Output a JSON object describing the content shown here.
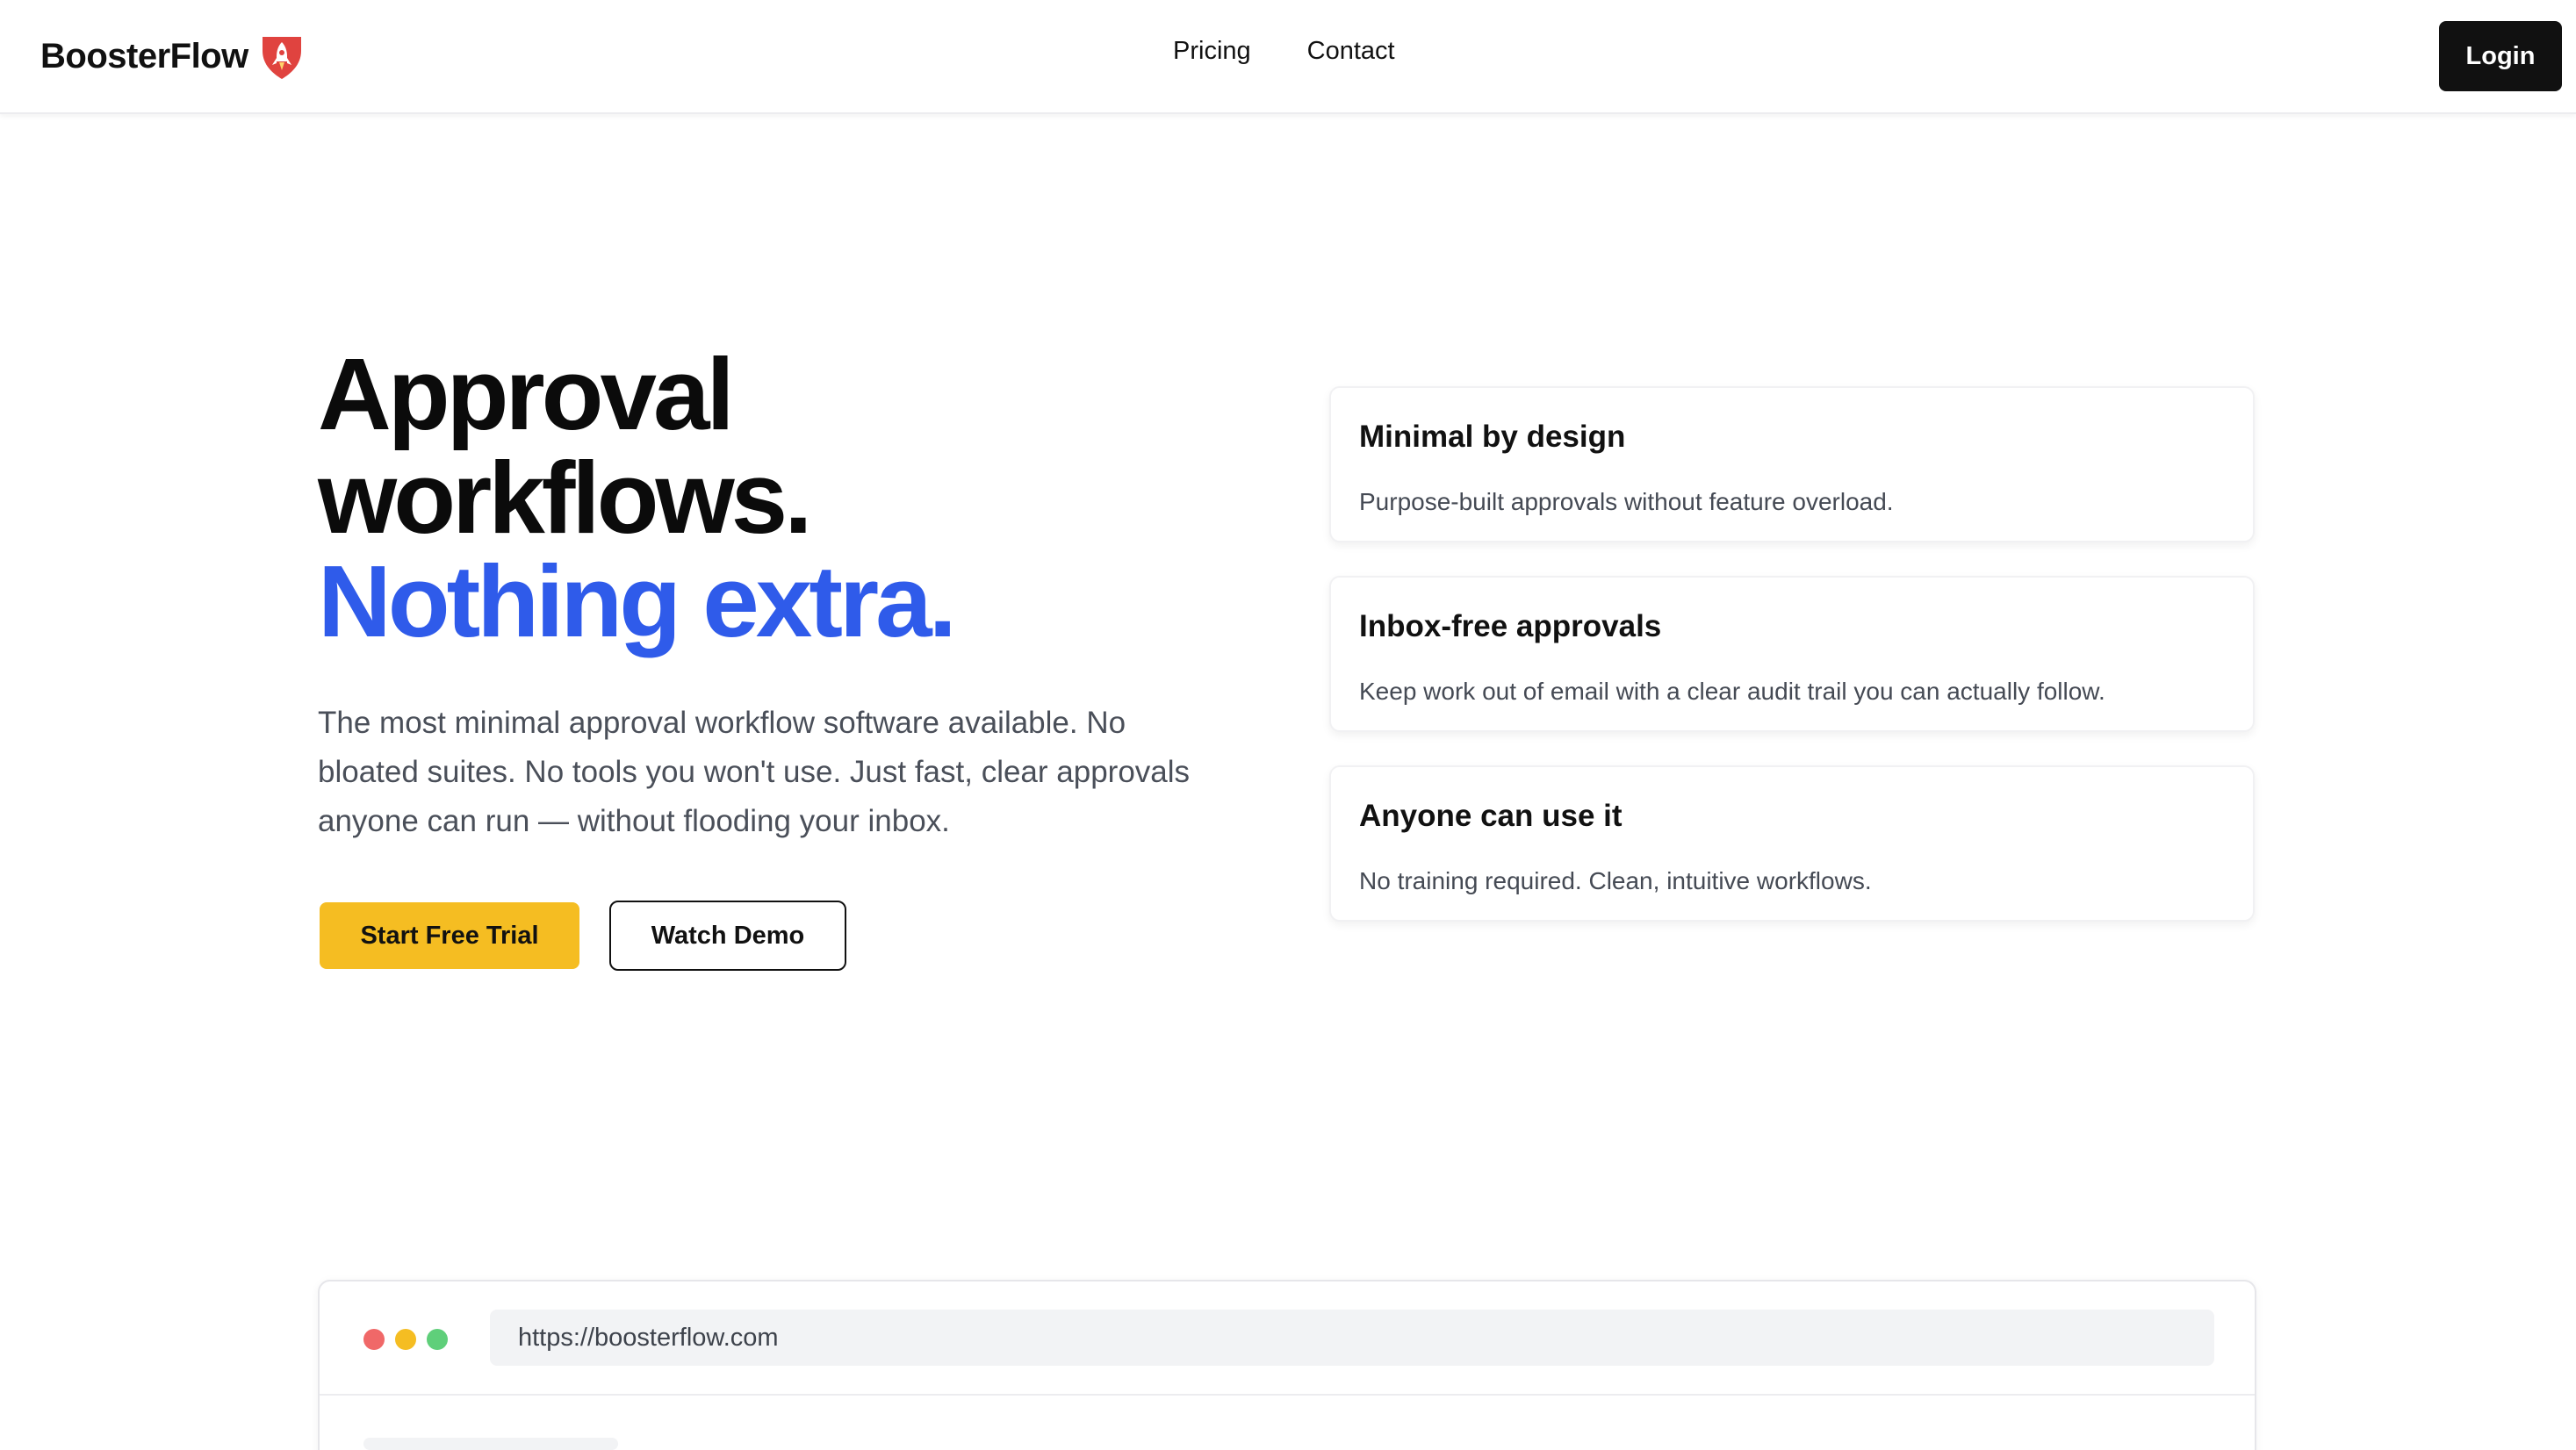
{
  "header": {
    "brand": "BoosterFlow",
    "brand_icon": "rocket-shield-icon",
    "nav": [
      {
        "label": "Pricing"
      },
      {
        "label": "Contact"
      }
    ],
    "login_label": "Login"
  },
  "hero": {
    "title_line1": "Approval",
    "title_line2": "workflows.",
    "title_accent": "Nothing extra.",
    "subtitle": "The most minimal approval workflow software available. No bloated suites. No tools you won't use. Just fast, clear approvals anyone can run — without flooding your inbox.",
    "primary_cta": "Start Free Trial",
    "secondary_cta": "Watch Demo"
  },
  "features": [
    {
      "title": "Minimal by design",
      "description": "Purpose-built approvals without feature overload."
    },
    {
      "title": "Inbox-free approvals",
      "description": "Keep work out of email with a clear audit trail you can actually follow."
    },
    {
      "title": "Anyone can use it",
      "description": "No training required. Clean, intuitive workflows."
    }
  ],
  "browser_preview": {
    "url": "https://boosterflow.com"
  },
  "colors": {
    "accent_blue": "#2f5bea",
    "cta_yellow": "#f5bd22",
    "dark": "#111111",
    "dot_red": "#f06868",
    "dot_yellow": "#f5bd22",
    "dot_green": "#5fcf7a",
    "brand_red": "#e0433f"
  }
}
